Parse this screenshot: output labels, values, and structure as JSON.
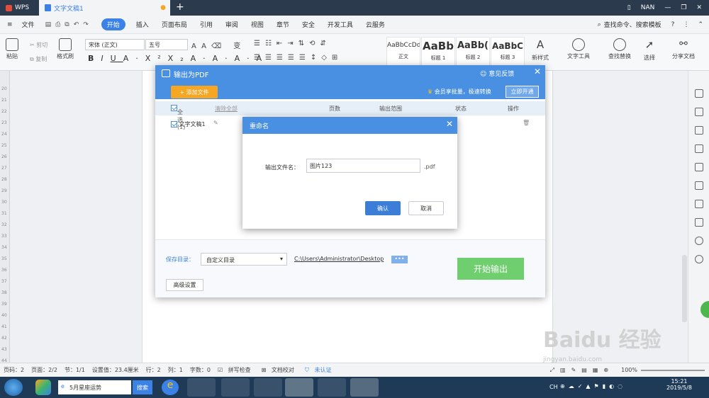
{
  "tabs": {
    "app": "WPS",
    "doc": "文字文稿1",
    "user": "NAN"
  },
  "menu": [
    "文件",
    "开始",
    "插入",
    "页面布局",
    "引用",
    "审阅",
    "视图",
    "章节",
    "安全",
    "开发工具",
    "云服务"
  ],
  "menu_active": "开始",
  "search_cmd": "查找命令、搜索模板",
  "ribbon": {
    "paste": "粘贴",
    "cut": "剪切",
    "copy": "复制",
    "format_painter": "格式刷",
    "font": "宋体 (正文)",
    "size": "五号",
    "styles": [
      {
        "preview": "AaBbCcDd",
        "name": "正文"
      },
      {
        "preview": "AaBb",
        "name": "标题 1"
      },
      {
        "preview": "AaBb(",
        "name": "标题 2"
      },
      {
        "preview": "AaBbC",
        "name": "标题 3"
      }
    ],
    "new_style": "新样式",
    "text_tool": "文字工具",
    "find_replace": "查找替换",
    "select": "选择",
    "share": "分享文档"
  },
  "ruler_nums": [
    "20",
    "21",
    "22",
    "23",
    "24",
    "25",
    "26",
    "27",
    "28",
    "29",
    "30",
    "31",
    "32",
    "33",
    "34",
    "35",
    "36",
    "37",
    "38",
    "39",
    "40",
    "41",
    "42",
    "43",
    "44"
  ],
  "pdf_dialog": {
    "title": "输出为PDF",
    "feedback": "意见反馈",
    "add_file": "添加文件",
    "member_text": "会员享批量，极速转换",
    "open_btn": "立即开通",
    "select_all": "全选 (1)",
    "clear_all": "清除全部",
    "col_pages": "页数",
    "col_range": "输出范围",
    "col_status": "状态",
    "col_ops": "操作",
    "file_name": "文字文稿1",
    "save_dir_label": "保存目录：",
    "save_dir_option": "自定义目录",
    "save_path": "C:\\Users\\Administrator\\Desktop",
    "dots": "•••",
    "start_btn": "开始输出",
    "advanced": "高级设置"
  },
  "rename": {
    "title": "重命名",
    "label": "输出文件名：",
    "value": "图片123",
    "ext": ".pdf",
    "ok": "确认",
    "cancel": "取消"
  },
  "status": {
    "page": "页码：2",
    "pages": "页面：2/2",
    "section": "节：1/1",
    "setting": "设置值：23.4厘米",
    "row": "行：2",
    "col": "列：1",
    "words": "字数：0",
    "spell": "拼写检查",
    "proof": "文档校对",
    "cert": "未认证",
    "zoom": "100%"
  },
  "taskbar": {
    "search_placeholder": "5月星座运势",
    "search_btn": "搜索",
    "lang": "CH",
    "time": "15:21",
    "date": "2019/5/8"
  },
  "watermark": "Baidu 经验",
  "watermark_sub": "jingyan.baidu.com"
}
